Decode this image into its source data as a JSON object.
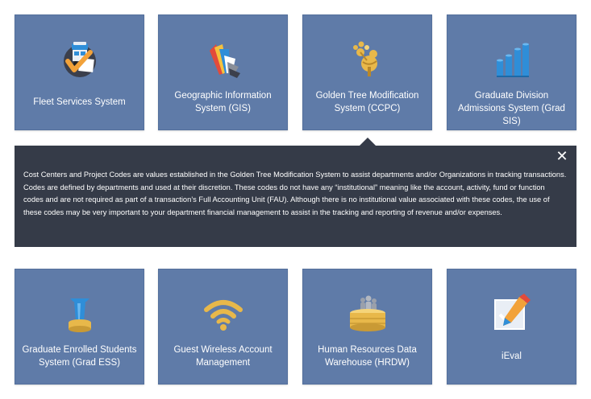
{
  "tiles_top": [
    {
      "label": "Fleet Services System",
      "icon": "fleet-truck-check-icon"
    },
    {
      "label": "Geographic Information System (GIS)",
      "icon": "color-swatch-fan-icon"
    },
    {
      "label": "Golden Tree Modification System (CCPC)",
      "icon": "golden-tree-icon"
    },
    {
      "label": "Graduate Division Admissions System (Grad SIS)",
      "icon": "bar-cylinders-icon"
    }
  ],
  "detail_panel": {
    "close_label": "✕",
    "description": "Cost Centers and Project Codes are values established in the Golden Tree Modification System to assist departments and/or Organizations in tracking transactions. Codes are defined by departments and used at their discretion. These codes do not have any “institutional” meaning like the account, activity, fund or function codes and are not required as part of a transaction’s Full Accounting Unit (FAU). Although there is no institutional value associated with these codes, the use of these codes may be very important to your department financial management to assist in the tracking and reporting of revenue and/or expenses."
  },
  "tiles_bottom": [
    {
      "label": "Graduate Enrolled Students System (Grad ESS)",
      "icon": "graduate-cap-icon"
    },
    {
      "label": "Guest Wireless Account Management",
      "icon": "wifi-icon"
    },
    {
      "label": "Human Resources Data Warehouse (HRDW)",
      "icon": "people-database-icon"
    },
    {
      "label": "iEval",
      "icon": "pencil-checkbox-icon"
    }
  ],
  "colors": {
    "tile_bg": "#5f7ba8",
    "panel_bg": "#353b48",
    "gold": "#e8b84a",
    "blue": "#2f8ed8"
  }
}
